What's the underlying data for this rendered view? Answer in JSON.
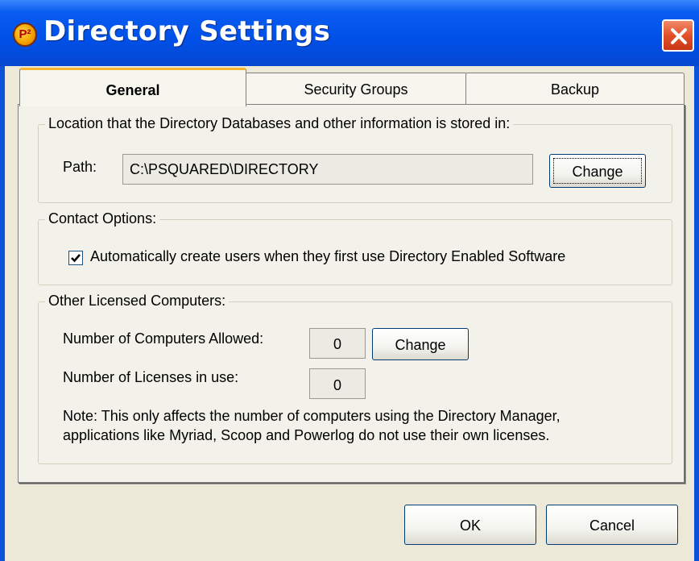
{
  "window": {
    "title": "Directory Settings",
    "app_icon_text": "P²",
    "close_icon": "close-x-icon"
  },
  "tabs": [
    {
      "label": "General"
    },
    {
      "label": "Security Groups"
    },
    {
      "label": "Backup"
    }
  ],
  "location_group": {
    "legend": "Location that the Directory Databases and other information is stored in:",
    "path_label": "Path:",
    "path_value": "C:\\PSQUARED\\DIRECTORY",
    "change_button": "Change"
  },
  "contact_group": {
    "legend": "Contact Options:",
    "auto_create_checked": true,
    "auto_create_label": "Automatically create users when they first use Directory Enabled Software"
  },
  "licensed_group": {
    "legend": "Other Licensed Computers:",
    "allowed_label": "Number of Computers Allowed:",
    "allowed_value": "0",
    "change_button": "Change",
    "in_use_label": "Number of Licenses in use:",
    "in_use_value": "0",
    "note_line1": "Note: This only affects the number of computers using the Directory Manager,",
    "note_line2": "applications like Myriad, Scoop and Powerlog do not use their own licenses."
  },
  "footer": {
    "ok_button": "OK",
    "cancel_button": "Cancel"
  },
  "colors": {
    "titlebar": "#0050e8",
    "close": "#e2502a",
    "dialog_bg": "#ece9d8",
    "tab_highlight": "#f3b432"
  }
}
